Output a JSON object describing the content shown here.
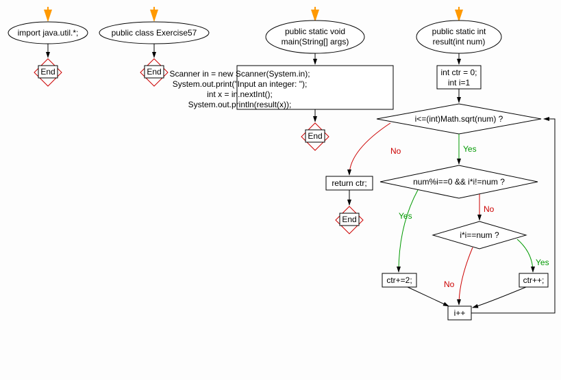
{
  "chart_data": {
    "type": "flowchart",
    "nodes": [
      {
        "id": "n1",
        "shape": "ellipse",
        "text": "import java.util.*;"
      },
      {
        "id": "n2",
        "shape": "end",
        "text": "End"
      },
      {
        "id": "n3",
        "shape": "ellipse",
        "text": "public class Exercise57"
      },
      {
        "id": "n4",
        "shape": "end",
        "text": "End"
      },
      {
        "id": "n5",
        "shape": "ellipse",
        "text": "public static void\nmain(String[] args)"
      },
      {
        "id": "n6",
        "shape": "rect",
        "text": "Scanner in = new Scanner(System.in);\nSystem.out.print(\"Input an integer: \");\nint x = in.nextInt();\nSystem.out.println(result(x));"
      },
      {
        "id": "n7",
        "shape": "end",
        "text": "End"
      },
      {
        "id": "n8",
        "shape": "ellipse",
        "text": "public static int\nresult(int num)"
      },
      {
        "id": "n9",
        "shape": "rect",
        "text": "int ctr = 0;\nint i=1"
      },
      {
        "id": "n10",
        "shape": "diamond",
        "text": "i<=(int)Math.sqrt(num) ?"
      },
      {
        "id": "n11",
        "shape": "rect",
        "text": "return ctr;"
      },
      {
        "id": "n12",
        "shape": "end",
        "text": "End"
      },
      {
        "id": "n13",
        "shape": "diamond",
        "text": "num%i==0 && i*i!=num ?"
      },
      {
        "id": "n14",
        "shape": "diamond",
        "text": "i*i==num ?"
      },
      {
        "id": "n15",
        "shape": "rect",
        "text": "ctr+=2;"
      },
      {
        "id": "n16",
        "shape": "rect",
        "text": "ctr++;"
      },
      {
        "id": "n17",
        "shape": "rect",
        "text": "i++"
      }
    ],
    "edges": [
      {
        "from": "entry1",
        "to": "n1"
      },
      {
        "from": "n1",
        "to": "n2"
      },
      {
        "from": "entry3",
        "to": "n3"
      },
      {
        "from": "n3",
        "to": "n4"
      },
      {
        "from": "entry5",
        "to": "n5"
      },
      {
        "from": "n5",
        "to": "n6"
      },
      {
        "from": "n6",
        "to": "n7"
      },
      {
        "from": "entry8",
        "to": "n8"
      },
      {
        "from": "n8",
        "to": "n9"
      },
      {
        "from": "n9",
        "to": "n10"
      },
      {
        "from": "n10",
        "to": "n11",
        "label": "No"
      },
      {
        "from": "n10",
        "to": "n13",
        "label": "Yes"
      },
      {
        "from": "n11",
        "to": "n12"
      },
      {
        "from": "n13",
        "to": "n15",
        "label": "Yes"
      },
      {
        "from": "n13",
        "to": "n14",
        "label": "No"
      },
      {
        "from": "n14",
        "to": "n16",
        "label": "Yes"
      },
      {
        "from": "n14",
        "to": "n17",
        "label": "No"
      },
      {
        "from": "n15",
        "to": "n17"
      },
      {
        "from": "n16",
        "to": "n17"
      },
      {
        "from": "n17",
        "to": "n10"
      }
    ],
    "labels": {
      "yes": "Yes",
      "no": "No"
    }
  },
  "n1": "import java.util.*;",
  "n2": "End",
  "n3": "public class Exercise57",
  "n4": "End",
  "n5a": "public static void",
  "n5b": "main(String[] args)",
  "n6a": "Scanner in = new Scanner(System.in);",
  "n6b": "System.out.print(\"Input an integer: \");",
  "n6c": "int x = in.nextInt();",
  "n6d": "System.out.println(result(x));",
  "n7": "End",
  "n8a": "public static int",
  "n8b": "result(int num)",
  "n9a": "int ctr = 0;",
  "n9b": "int i=1",
  "n10": "i<=(int)Math.sqrt(num) ?",
  "n11": "return ctr;",
  "n12": "End",
  "n13": "num%i==0 && i*i!=num ?",
  "n14": "i*i==num ?",
  "n15": "ctr+=2;",
  "n16": "ctr++;",
  "n17": "i++",
  "yes": "Yes",
  "no": "No"
}
